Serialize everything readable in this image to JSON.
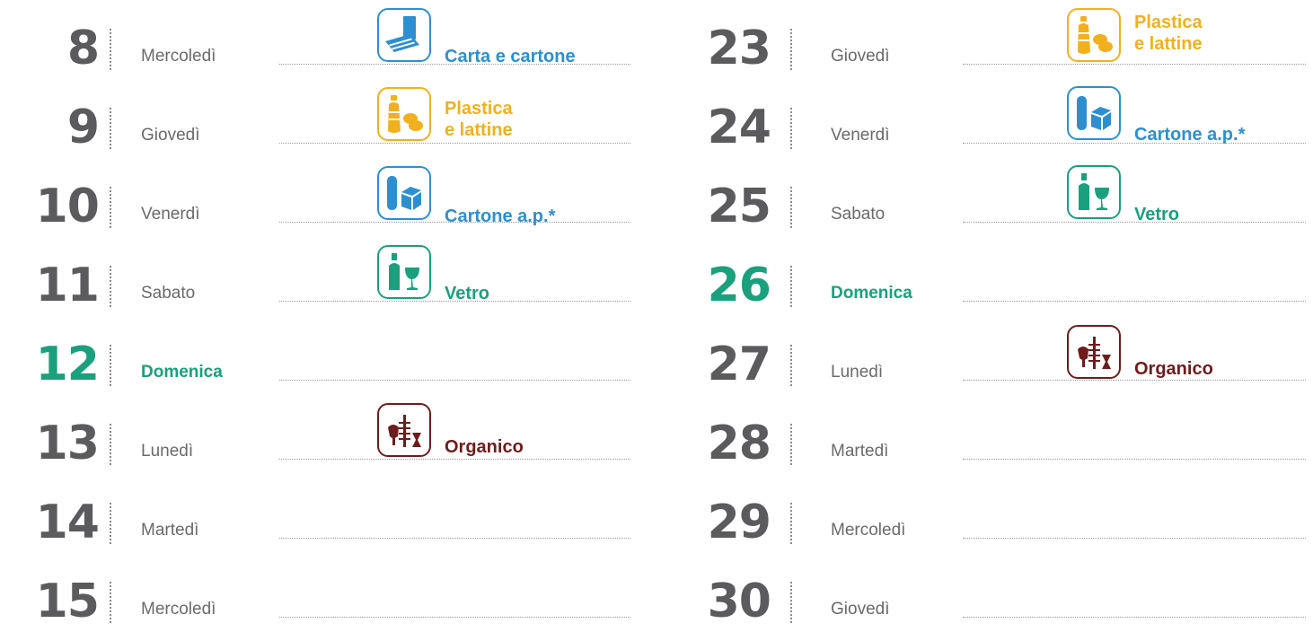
{
  "colors": {
    "day_number": "#5b5b5d",
    "sunday": "#1aa07c",
    "paper": "#2d8fd0",
    "plastic": "#f2b01e",
    "carton": "#2d8fd0",
    "glass": "#1aa07c",
    "organic": "#6e1c1c"
  },
  "left": [
    {
      "num": "8",
      "name": "Mercoledì"
    },
    {
      "num": "9",
      "name": "Giovedì"
    },
    {
      "num": "10",
      "name": "Venerdì"
    },
    {
      "num": "11",
      "name": "Sabato"
    },
    {
      "num": "12",
      "name": "Domenica"
    },
    {
      "num": "13",
      "name": "Lunedì"
    },
    {
      "num": "14",
      "name": "Martedì"
    },
    {
      "num": "15",
      "name": "Mercoledì"
    }
  ],
  "right": [
    {
      "num": "23",
      "name": "Giovedì"
    },
    {
      "num": "24",
      "name": "Venerdì"
    },
    {
      "num": "25",
      "name": "Sabato"
    },
    {
      "num": "26",
      "name": "Domenica"
    },
    {
      "num": "27",
      "name": "Lunedì"
    },
    {
      "num": "28",
      "name": "Martedì"
    },
    {
      "num": "29",
      "name": "Mercoledì"
    },
    {
      "num": "30",
      "name": "Giovedì"
    }
  ],
  "collections": {
    "l8": {
      "line1": "Carta e cartone",
      "icon": "paper-carton-icon"
    },
    "l9": {
      "line1": "Plastica",
      "line2": "e lattine",
      "icon": "plastic-cans-icon"
    },
    "l10": {
      "line1": "Cartone a.p.*",
      "icon": "beverage-carton-icon"
    },
    "l11": {
      "line1": "Vetro",
      "icon": "glass-icon"
    },
    "l13": {
      "line1": "Organico",
      "icon": "organic-icon"
    },
    "r23": {
      "line1": "Plastica",
      "line2": "e lattine",
      "icon": "plastic-cans-icon"
    },
    "r24": {
      "line1": "Cartone a.p.*",
      "icon": "beverage-carton-icon"
    },
    "r25": {
      "line1": "Vetro",
      "icon": "glass-icon"
    },
    "r27": {
      "line1": "Organico",
      "icon": "organic-icon"
    }
  }
}
